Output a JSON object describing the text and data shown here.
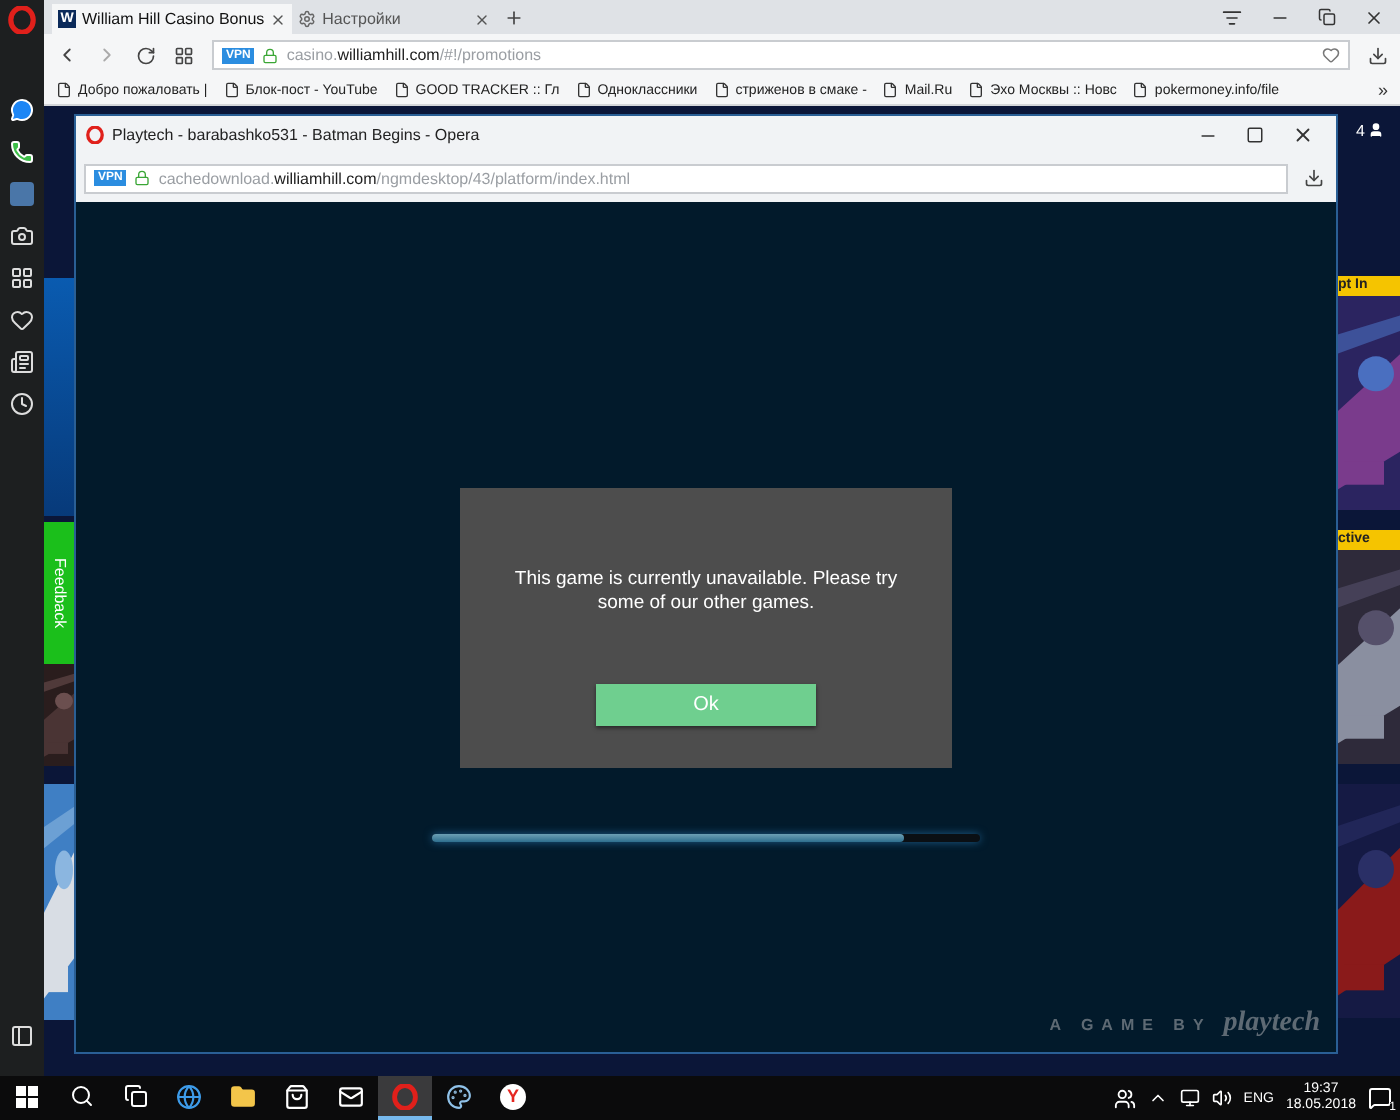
{
  "browser": {
    "tabs": [
      {
        "kind": "favicon",
        "favicon": "W",
        "label": "William Hill Casino Bonus",
        "selected": true
      },
      {
        "kind": "settings",
        "label": "Настройки",
        "selected": false
      }
    ],
    "address": {
      "vpn": "VPN",
      "url": "casino.**williamhill.com**/#!/promotions"
    },
    "bookmarks": [
      "Добро пожаловать |",
      "Блок-пост - YouTube",
      "GOOD TRACKER :: Гл",
      "Одноклассники",
      "стриженов в смаке -",
      "Mail.Ru",
      "Эхо Москвы :: Новс",
      "pokermoney.info/file"
    ],
    "bookmarks_more": "»"
  },
  "site": {
    "account_count": "4",
    "feedback": "Feedback",
    "badges": [
      "pt In",
      "ctive"
    ]
  },
  "popup": {
    "title": "Playtech - barabashko531 - Batman Begins - Opera",
    "address": {
      "vpn": "VPN",
      "url": "cachedownload.**williamhill.com**/ngmdesktop/43/platform/index.html"
    },
    "dialog": {
      "message": "This game is currently unavailable. Please try some of our other games.",
      "button": "Ok"
    },
    "loader": {
      "level": 0.86
    },
    "footer": "A GAME BY",
    "logo": "playtech"
  },
  "taskbar": {
    "apps": [
      {
        "kind": "edge",
        "selected": false
      },
      {
        "kind": "folder",
        "selected": false
      },
      {
        "kind": "store",
        "selected": false
      },
      {
        "kind": "mail",
        "selected": false
      },
      {
        "kind": "opera",
        "selected": true
      },
      {
        "kind": "paint",
        "selected": false
      },
      {
        "kind": "yandex",
        "letter": "Y",
        "selected": false
      }
    ],
    "language": "ENG",
    "time": "19:37",
    "date": "18.05.2018",
    "notifications": "1"
  }
}
